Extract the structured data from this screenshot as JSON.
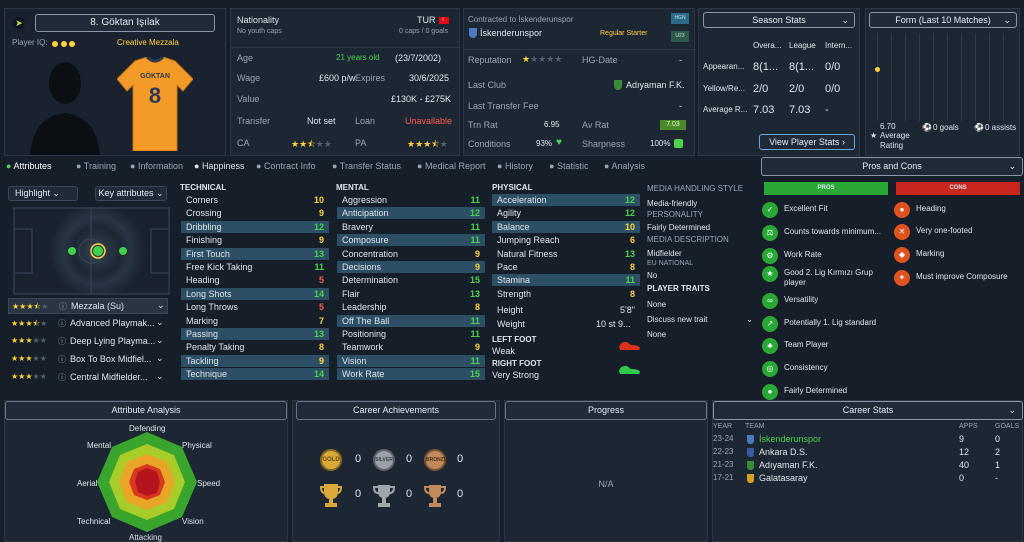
{
  "player": {
    "name": "8. Göktan Işılak",
    "player_iq_label": "Player IQ:",
    "role_tag": "Creative Mezzala",
    "shirt_name": "GÖKTAN",
    "shirt_number": "8"
  },
  "info": {
    "nationality_label": "Nationality",
    "nationality_value": "TUR",
    "nationality_sub": "No youth caps",
    "caps": "0 caps / 0 goals",
    "age_label": "Age",
    "age_text": "21 years old",
    "dob": "(23/7/2002)",
    "wage_label": "Wage",
    "wage_value": "£600 p/w",
    "expires_label": "Expires",
    "expires_value": "30/6/2025",
    "value_label": "Value",
    "value_value": "£130K - £275K",
    "transfer_label": "Transfer",
    "transfer_value": "Not set",
    "loan_label": "Loan",
    "loan_value": "Unavailable",
    "ca_label": "CA",
    "pa_label": "PA",
    "ca_stars": 2.5,
    "pa_stars": 3.5
  },
  "club": {
    "contracted_label": "Contracted to İskenderunspor",
    "club_name": "İskenderunspor",
    "squad_status": "Regular Starter",
    "badge_top": "HGN",
    "badge_bottom": "U23",
    "reputation_label": "Reputation",
    "reputation_stars": 1,
    "hg_label": "HG-Date",
    "hg_value": "-",
    "last_club_label": "Last Club",
    "last_club_value": "Adıyaman F.K.",
    "last_fee_label": "Last Transfer Fee",
    "last_fee_value": "-",
    "trn_label": "Trn Rat",
    "trn_value": "6.95",
    "av_label": "Av Rat",
    "av_value": "7.03",
    "conditions_label": "Conditions",
    "conditions_value": "93%",
    "sharpness_label": "Sharpness",
    "sharpness_value": "100%"
  },
  "season_stats": {
    "title": "Season Stats",
    "columns": [
      "Overa...",
      "League",
      "Intern..."
    ],
    "rows": [
      {
        "label": "Appearan...",
        "values": [
          "8(1...",
          "8(1...",
          "0/0"
        ]
      },
      {
        "label": "Yellow/Re...",
        "values": [
          "2/0",
          "2/0",
          "0/0"
        ]
      },
      {
        "label": "Average R...",
        "values": [
          "7.03",
          "7.03",
          "-"
        ]
      }
    ],
    "button": "View Player Stats"
  },
  "form": {
    "title": "Form (Last 10 Matches)",
    "avg_value": "6.70",
    "avg_label": "Average",
    "avg_label2": "Rating",
    "goals": "0 goals",
    "assists": "0 assists"
  },
  "tabs": [
    "Attributes",
    "Training",
    "Information",
    "Happiness",
    "Contract Info",
    "Transfer Status",
    "Medical Report",
    "History",
    "Statistic",
    "Analysis"
  ],
  "highlight": {
    "label": "Highlight",
    "key_attr": "Key attributes"
  },
  "roles": [
    {
      "name": "Mezzala (Su)",
      "stars": 3.5
    },
    {
      "name": "Advanced Playmak...",
      "stars": 3.5
    },
    {
      "name": "Deep Lying Playma...",
      "stars": 3
    },
    {
      "name": "Box To Box Midfiel...",
      "stars": 3
    },
    {
      "name": "Central Midfielder...",
      "stars": 3
    }
  ],
  "technical": {
    "title": "TECHNICAL",
    "rows": [
      {
        "name": "Corners",
        "value": "10",
        "hl": false,
        "color": "yellow"
      },
      {
        "name": "Crossing",
        "value": "9",
        "hl": false,
        "color": "yellow"
      },
      {
        "name": "Dribbling",
        "value": "12",
        "hl": true,
        "color": "green"
      },
      {
        "name": "Finishing",
        "value": "9",
        "hl": false,
        "color": "yellow"
      },
      {
        "name": "First Touch",
        "value": "13",
        "hl": true,
        "color": "green"
      },
      {
        "name": "Free Kick Taking",
        "value": "11",
        "hl": false,
        "color": "green"
      },
      {
        "name": "Heading",
        "value": "5",
        "hl": false,
        "color": "red"
      },
      {
        "name": "Long Shots",
        "value": "14",
        "hl": true,
        "color": "green"
      },
      {
        "name": "Long Throws",
        "value": "5",
        "hl": false,
        "color": "red"
      },
      {
        "name": "Marking",
        "value": "7",
        "hl": false,
        "color": "yellow"
      },
      {
        "name": "Passing",
        "value": "13",
        "hl": true,
        "color": "green"
      },
      {
        "name": "Penalty Taking",
        "value": "8",
        "hl": false,
        "color": "yellow"
      },
      {
        "name": "Tackling",
        "value": "9",
        "hl": true,
        "color": "yellow"
      },
      {
        "name": "Technique",
        "value": "14",
        "hl": true,
        "color": "green"
      }
    ]
  },
  "mental": {
    "title": "MENTAL",
    "rows": [
      {
        "name": "Aggression",
        "value": "11",
        "hl": false,
        "color": "green"
      },
      {
        "name": "Anticipation",
        "value": "12",
        "hl": true,
        "color": "green"
      },
      {
        "name": "Bravery",
        "value": "11",
        "hl": false,
        "color": "green"
      },
      {
        "name": "Composure",
        "value": "11",
        "hl": true,
        "color": "green"
      },
      {
        "name": "Concentration",
        "value": "9",
        "hl": false,
        "color": "yellow"
      },
      {
        "name": "Decisions",
        "value": "9",
        "hl": true,
        "color": "yellow"
      },
      {
        "name": "Determination",
        "value": "15",
        "hl": false,
        "color": "green"
      },
      {
        "name": "Flair",
        "value": "13",
        "hl": false,
        "color": "green"
      },
      {
        "name": "Leadership",
        "value": "8",
        "hl": false,
        "color": "yellow"
      },
      {
        "name": "Off The Ball",
        "value": "11",
        "hl": true,
        "color": "green"
      },
      {
        "name": "Positioning",
        "value": "11",
        "hl": false,
        "color": "green"
      },
      {
        "name": "Teamwork",
        "value": "9",
        "hl": false,
        "color": "yellow"
      },
      {
        "name": "Vision",
        "value": "11",
        "hl": true,
        "color": "green"
      },
      {
        "name": "Work Rate",
        "value": "15",
        "hl": true,
        "color": "green"
      }
    ]
  },
  "physical": {
    "title": "PHYSICAL",
    "rows": [
      {
        "name": "Acceleration",
        "value": "12",
        "hl": true,
        "color": "green"
      },
      {
        "name": "Agility",
        "value": "12",
        "hl": false,
        "color": "green"
      },
      {
        "name": "Balance",
        "value": "10",
        "hl": true,
        "color": "yellow"
      },
      {
        "name": "Jumping Reach",
        "value": "6",
        "hl": false,
        "color": "yellow"
      },
      {
        "name": "Natural Fitness",
        "value": "13",
        "hl": false,
        "color": "green"
      },
      {
        "name": "Pace",
        "value": "8",
        "hl": false,
        "color": "yellow"
      },
      {
        "name": "Stamina",
        "value": "11",
        "hl": true,
        "color": "green"
      },
      {
        "name": "Strength",
        "value": "8",
        "hl": false,
        "color": "yellow"
      }
    ],
    "height_label": "Height",
    "height_value": "5'8\"",
    "weight_label": "Weight",
    "weight_value": "10 st 9...",
    "left_foot_label": "LEFT FOOT",
    "left_foot_value": "Weak",
    "right_foot_label": "RIGHT FOOT",
    "right_foot_value": "Very Strong"
  },
  "media": {
    "handling_title": "MEDIA HANDLING STYLE",
    "handling_value": "Media-friendly",
    "personality_title": "PERSONALITY",
    "personality_value": "Fairly Determined",
    "description_title": "MEDIA DESCRIPTION",
    "description_value": "Midfielder",
    "eu_title": "EU NATIONAL",
    "eu_value": "No",
    "traits_title": "PLAYER TRAITS",
    "traits_value": "None",
    "discuss_label": "Discuss new trait",
    "discuss_value": "None"
  },
  "pros_cons": {
    "title": "Pros and Cons",
    "pros_label": "PROS",
    "cons_label": "CONS",
    "pros": [
      "Excellent Fit",
      "Counts towards minimum...",
      "Work Rate",
      "Good 2. Lig Kırmızı Grup player",
      "Versatility",
      "Potentially 1. Lig standard",
      "Team Player",
      "Consistency",
      "Fairly Determined"
    ],
    "cons": [
      "Heading",
      "Very one-footed",
      "Marking",
      "Must improve Composure"
    ]
  },
  "attribute_analysis": {
    "title": "Attribute Analysis",
    "labels": [
      "Defending",
      "Physical",
      "Speed",
      "Vision",
      "Attacking",
      "Technical",
      "Aerial",
      "Mental"
    ]
  },
  "achievements": {
    "title": "Career Achievements",
    "gold": "0",
    "silver": "0",
    "bronze": "0",
    "trophy1": "0",
    "trophy2": "0",
    "trophy3": "0",
    "medal_gold_text": "GOLD",
    "medal_silver_text": "SILVER",
    "medal_bronze_text": "BRONZE"
  },
  "progress": {
    "title": "Progress",
    "value": "N/A"
  },
  "career_stats": {
    "title": "Career Stats",
    "columns": [
      "YEAR",
      "TEAM",
      "APPS",
      "GOALS"
    ],
    "rows": [
      {
        "year": "23-24",
        "team": "İskenderunspor",
        "apps": "9",
        "goals": "0",
        "current": true
      },
      {
        "year": "22-23",
        "team": "Ankara D.S.",
        "apps": "12",
        "goals": "2",
        "current": false
      },
      {
        "year": "21-23",
        "team": "Adıyaman F.K.",
        "apps": "40",
        "goals": "1",
        "current": false
      },
      {
        "year": "17-21",
        "team": "Galatasaray",
        "apps": "0",
        "goals": "-",
        "current": false
      }
    ]
  },
  "colors": {
    "accent_green": "#4cd24c",
    "yellow": "#ffd23c",
    "red": "#ff5a4a",
    "pros_green": "#2aa835",
    "cons_red": "#c9271e",
    "shirt_orange": "#f39a28"
  }
}
